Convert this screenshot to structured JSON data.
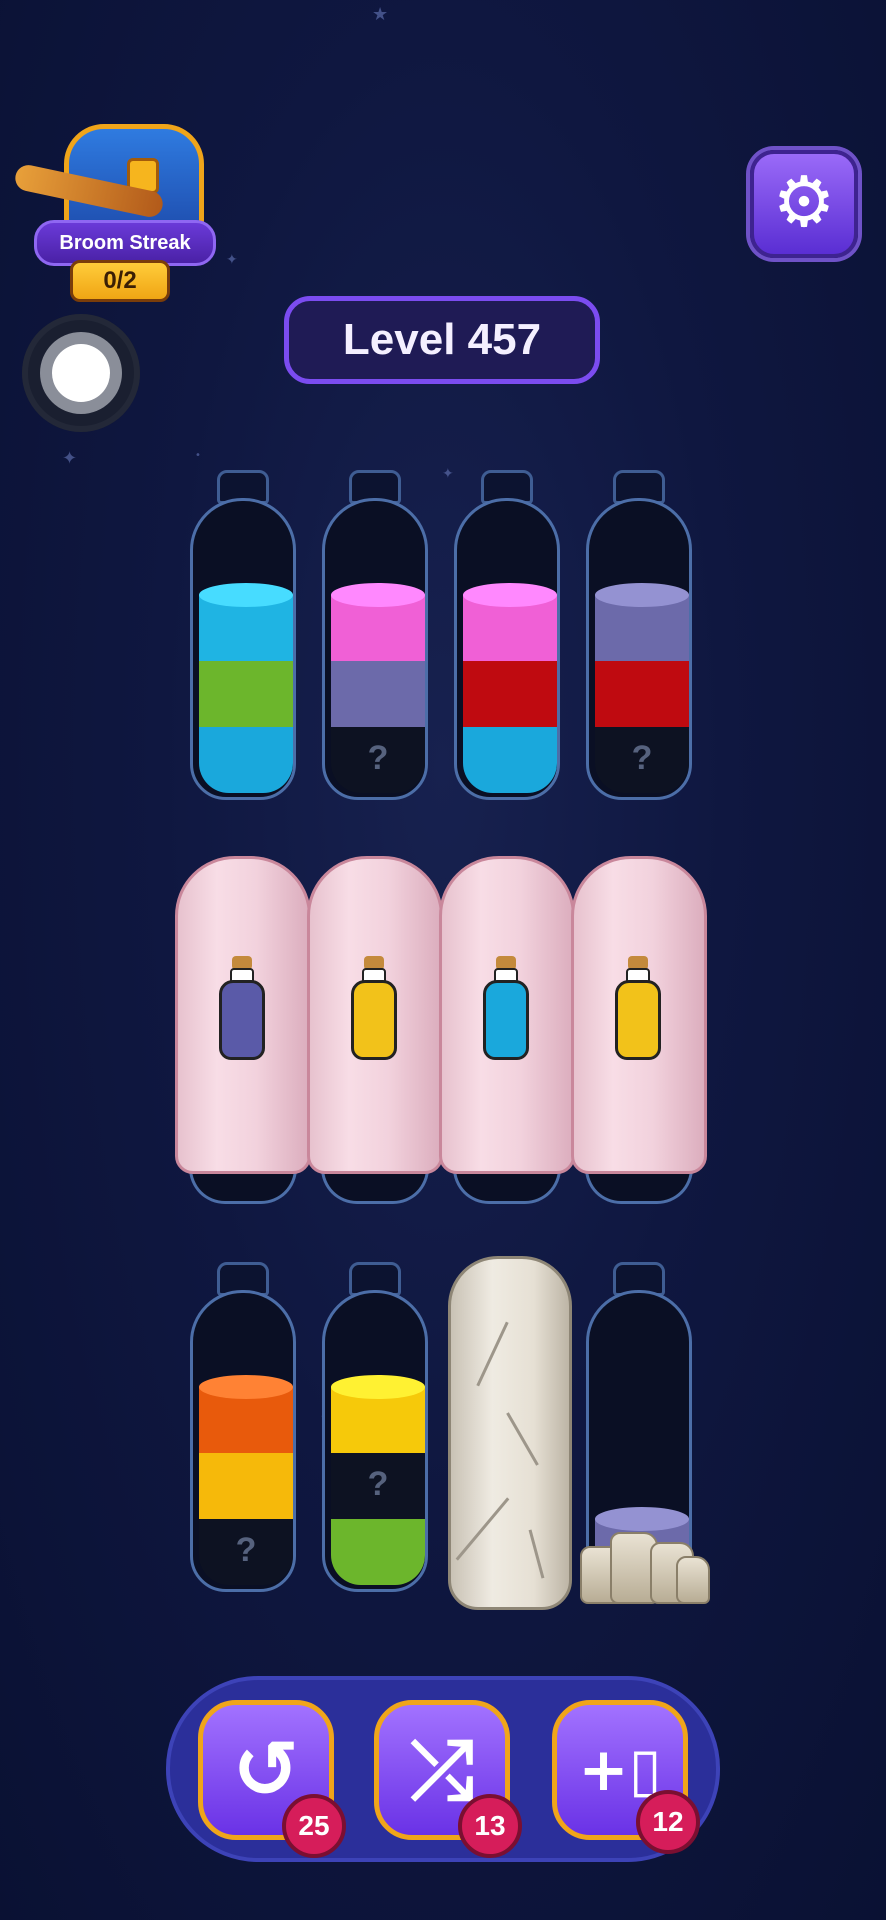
{
  "colors": {
    "background": "#0f1740",
    "accent": "#7b4cf0",
    "badge": "#d61d5a"
  },
  "chest": {
    "label": "Broom Streak",
    "progress": "0/2"
  },
  "level": {
    "label": "Level 457"
  },
  "settings": {
    "icon": "gear-icon"
  },
  "unknown_marker": "?",
  "bottles_row1": [
    {
      "name": "bottle-1",
      "layers": [
        "#1fb4e3",
        "#6cb62c",
        "#1aa8dc"
      ]
    },
    {
      "name": "bottle-2",
      "layers": [
        "#f060d6",
        "#6c6aaa",
        "unknown"
      ]
    },
    {
      "name": "bottle-3",
      "layers": [
        "#f060d6",
        "#bf0a10",
        "#1aa8dc"
      ]
    },
    {
      "name": "bottle-4",
      "layers": [
        "#6c6aaa",
        "#bf0a10",
        "unknown"
      ]
    }
  ],
  "ghost_bottles": [
    {
      "name": "ghost-bottle-1",
      "hint_color": "#5a5aa8"
    },
    {
      "name": "ghost-bottle-2",
      "hint_color": "#f2c21a"
    },
    {
      "name": "ghost-bottle-3",
      "hint_color": "#1aa8dc"
    },
    {
      "name": "ghost-bottle-4",
      "hint_color": "#f2c21a"
    }
  ],
  "bottles_row3": [
    {
      "name": "bottle-9",
      "layers": [
        "#e85a0c",
        "#f6b90a",
        "unknown"
      ]
    },
    {
      "name": "bottle-10",
      "layers": [
        "#f6c90a",
        "unknown",
        "#6cb62c"
      ]
    },
    {
      "name": "bottle-12",
      "layers": [
        "#6c6aaa"
      ]
    }
  ],
  "boosters": [
    {
      "name": "undo",
      "icon": "undo-icon",
      "count": "25"
    },
    {
      "name": "shuffle",
      "icon": "shuffle-icon",
      "count": "13"
    },
    {
      "name": "add-bottle",
      "icon": "add-bottle-icon",
      "count": "12"
    }
  ]
}
